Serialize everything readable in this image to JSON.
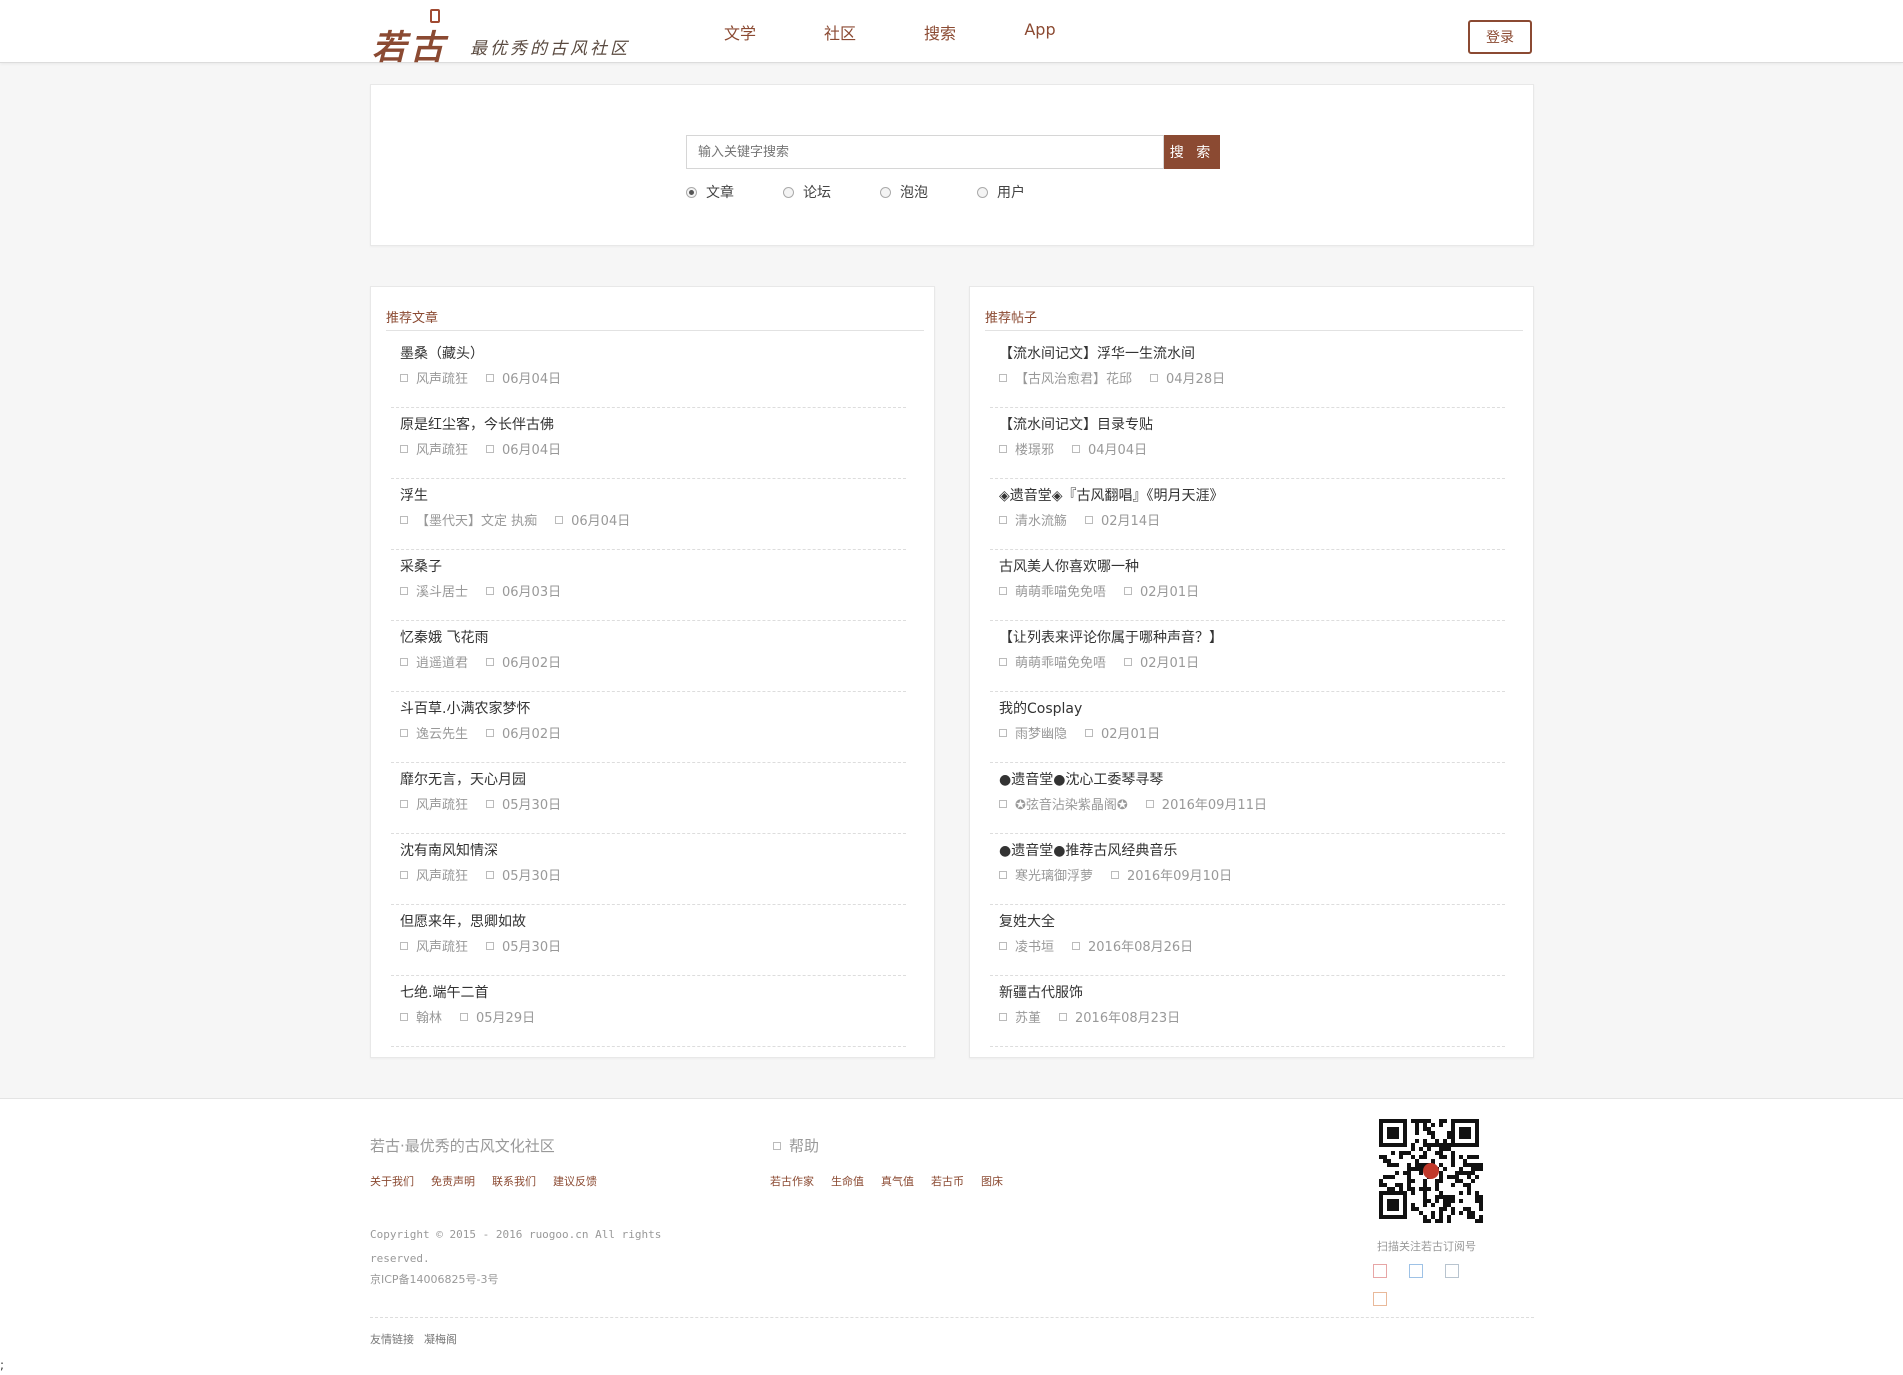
{
  "header": {
    "logo_main": "若古",
    "logo_sub": "最优秀的古风社区",
    "nav": [
      "文学",
      "社区",
      "搜索",
      "App"
    ],
    "login_label": "登录"
  },
  "search": {
    "placeholder": "输入关键字搜索",
    "button_label": "搜 索",
    "options": [
      {
        "label": "文章",
        "checked": true
      },
      {
        "label": "论坛",
        "checked": false
      },
      {
        "label": "泡泡",
        "checked": false
      },
      {
        "label": "用户",
        "checked": false
      }
    ]
  },
  "articles": {
    "title": "推荐文章",
    "items": [
      {
        "title": "墨桑（藏头）",
        "author": "风声疏狂",
        "date": "06月04日"
      },
      {
        "title": "原是红尘客，今长伴古佛",
        "author": "风声疏狂",
        "date": "06月04日"
      },
      {
        "title": "浮生",
        "author": "【墨代天】文定 执痴",
        "date": "06月04日"
      },
      {
        "title": "采桑子",
        "author": "溪斗居士",
        "date": "06月03日"
      },
      {
        "title": "忆秦娥 飞花雨",
        "author": "逍遥道君",
        "date": "06月02日"
      },
      {
        "title": "斗百草.小满农家梦怀",
        "author": "逸云先生",
        "date": "06月02日"
      },
      {
        "title": "靡尔无言，天心月园",
        "author": "风声疏狂",
        "date": "05月30日"
      },
      {
        "title": "沈有南风知情深",
        "author": "风声疏狂",
        "date": "05月30日"
      },
      {
        "title": "但愿来年，思卿如故",
        "author": "风声疏狂",
        "date": "05月30日"
      },
      {
        "title": "七绝.端午二首",
        "author": "翰林",
        "date": "05月29日"
      }
    ]
  },
  "posts": {
    "title": "推荐帖子",
    "items": [
      {
        "title": "【流水间记文】浮华一生流水间",
        "author": "【古风治愈君】花邱",
        "date": "04月28日"
      },
      {
        "title": "【流水间记文】目录专贴",
        "author": "楼璟邪",
        "date": "04月04日"
      },
      {
        "title": "◈遗音堂◈『古风翻唱』《明月天涯》",
        "author": "清水流觞",
        "date": "02月14日"
      },
      {
        "title": "古风美人你喜欢哪一种",
        "author": "萌萌乖喵免免唔",
        "date": "02月01日"
      },
      {
        "title": "【让列表来评论你属于哪种声音？】",
        "author": "萌萌乖喵免免唔",
        "date": "02月01日"
      },
      {
        "title": "我的Cosplay",
        "author": "雨梦幽隐",
        "date": "02月01日"
      },
      {
        "title": "●遗音堂●沈心工委琴寻琴",
        "author": "✪弦音沾染紫晶阁✪",
        "date": "2016年09月11日"
      },
      {
        "title": "●遗音堂●推荐古风经典音乐",
        "author": "寒光璃御浮萝",
        "date": "2016年09月10日"
      },
      {
        "title": "复姓大全",
        "author": "凌书垣",
        "date": "2016年08月26日"
      },
      {
        "title": "新疆古代服饰",
        "author": "苏堇",
        "date": "2016年08月23日"
      }
    ]
  },
  "footer": {
    "brand": "若古·最优秀的古风文化社区",
    "links": [
      "关于我们",
      "免责声明",
      "联系我们",
      "建议反馈"
    ],
    "copyright": "Copyright © 2015 - 2016 ruogoo.cn All rights reserved.",
    "icp": "京ICP备14006825号-3号",
    "help_title": "帮助",
    "help_links": [
      "若古作家",
      "生命值",
      "真气值",
      "若古币",
      "图床"
    ],
    "qr_caption": "扫描关注若古订阅号",
    "friends_label": "友情链接",
    "friends": [
      "凝梅阁"
    ],
    "stray_text": ";",
    "colors": {
      "accent": "#8b4a32",
      "muted": "#999999"
    }
  }
}
